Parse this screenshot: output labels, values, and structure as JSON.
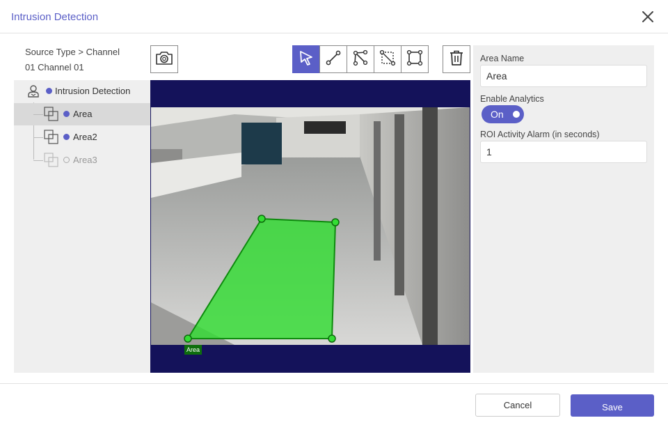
{
  "dialog": {
    "title": "Intrusion Detection"
  },
  "source": {
    "label": "Source Type > Channel",
    "value": "01 Channel 01"
  },
  "tree": {
    "root": {
      "label": "Intrusion Detection"
    },
    "items": [
      {
        "label": "Area",
        "state": "selected"
      },
      {
        "label": "Area2",
        "state": "normal"
      },
      {
        "label": "Area3",
        "state": "disabled"
      }
    ]
  },
  "toolbar": {
    "snapshot_icon": "camera-icon",
    "tools": [
      "select-pointer-icon",
      "line-icon",
      "polyline-icon",
      "rectangle-dashed-icon",
      "polygon-icon"
    ],
    "active_tool": "select-pointer-icon",
    "delete_icon": "trash-icon"
  },
  "video": {
    "roi_label": "Area"
  },
  "settings": {
    "area_name_label": "Area Name",
    "area_name_value": "Area",
    "enable_analytics_label": "Enable Analytics",
    "enable_analytics_toggle": "On",
    "roi_alarm_label": "ROI Activity Alarm (in seconds)",
    "roi_alarm_value": "1"
  },
  "footer": {
    "cancel_label": "Cancel",
    "save_label": "Save"
  },
  "colors": {
    "accent": "#5b5fc7",
    "video_bg": "#14125a",
    "roi_fill": "#33dd33"
  }
}
